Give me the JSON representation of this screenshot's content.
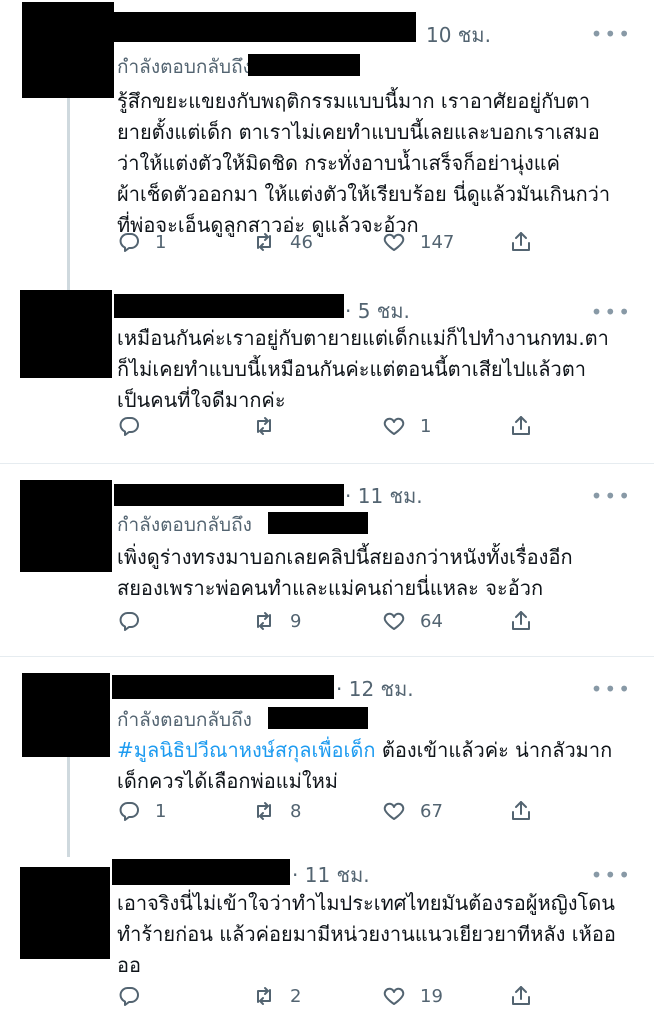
{
  "tweets": [
    {
      "time": "10 ชม.",
      "more": "•••",
      "reply_to_label": "กำลังตอบกลับถึง",
      "text": "รู้สึกขยะแขยงกับพฤติกรรมแบบนี้มาก เราอาศัยอยู่กับตา\nยายตั้งแต่เด็ก ตาเราไม่เคยทำแบบนี้เลยและบอกเราเสมอ\nว่าให้แต่งตัวให้มิดชิด กระทั่งอาบน้ำเสร็จก็อย่านุ่งแค่\nผ้าเช็ดตัวออกมา ให้แต่งตัวให้เรียบร้อย นี่ดูแล้วมันเกินกว่า\nที่พ่อจะเอ็นดูลูกสาวอ่ะ ดูแล้วจะอ้วก",
      "replies": "1",
      "retweets": "46",
      "likes": "147"
    },
    {
      "time": "· 5 ชม.",
      "more": "•••",
      "text": "เหมือนกันค่ะเราอยู่กับตายายแต่เด็กแม่ก็ไปทำงานกทม.ตา\nก็ไม่เคยทำแบบนี้เหมือนกันค่ะแต่ตอนนี้ตาเสียไปแล้วตา\nเป็นคนที่ใจดีมากค่ะ",
      "replies": "",
      "retweets": "",
      "likes": "1"
    },
    {
      "time": "· 11 ชม.",
      "more": "•••",
      "reply_to_label": "กำลังตอบกลับถึง",
      "text": "เพิ่งดูร่างทรงมาบอกเลยคลิปนี้สยองกว่าหนังทั้งเรื่องอีก\nสยองเพราะพ่อคนทำและแม่คนถ่ายนี่แหละ จะอ้วก",
      "replies": "",
      "retweets": "9",
      "likes": "64"
    },
    {
      "time": "· 12 ชม.",
      "more": "•••",
      "reply_to_label": "กำลังตอบกลับถึง",
      "hashtag": "#มูลนิธิปวีณาหงษ์สกุลเพื่อเด็ก",
      "text": " ต้องเข้าแล้วค่ะ น่ากลัวมาก\nเด็กควรได้เลือกพ่อแม่ใหม่",
      "replies": "1",
      "retweets": "8",
      "likes": "67"
    },
    {
      "time": "· 11 ชม.",
      "more": "•••",
      "text": "เอาจริงนี่ไม่เข้าใจว่าทำไมประเทศไทยมันต้องรอผู้หญิงโดน\nทำร้ายก่อน แล้วค่อยมามีหน่วยงานแนวเยียวยาทีหลัง เห้ออ\nออ",
      "replies": "",
      "retweets": "2",
      "likes": "19"
    }
  ],
  "icons": {
    "reply": "reply-icon",
    "retweet": "retweet-icon",
    "like": "like-icon",
    "share": "share-icon"
  }
}
